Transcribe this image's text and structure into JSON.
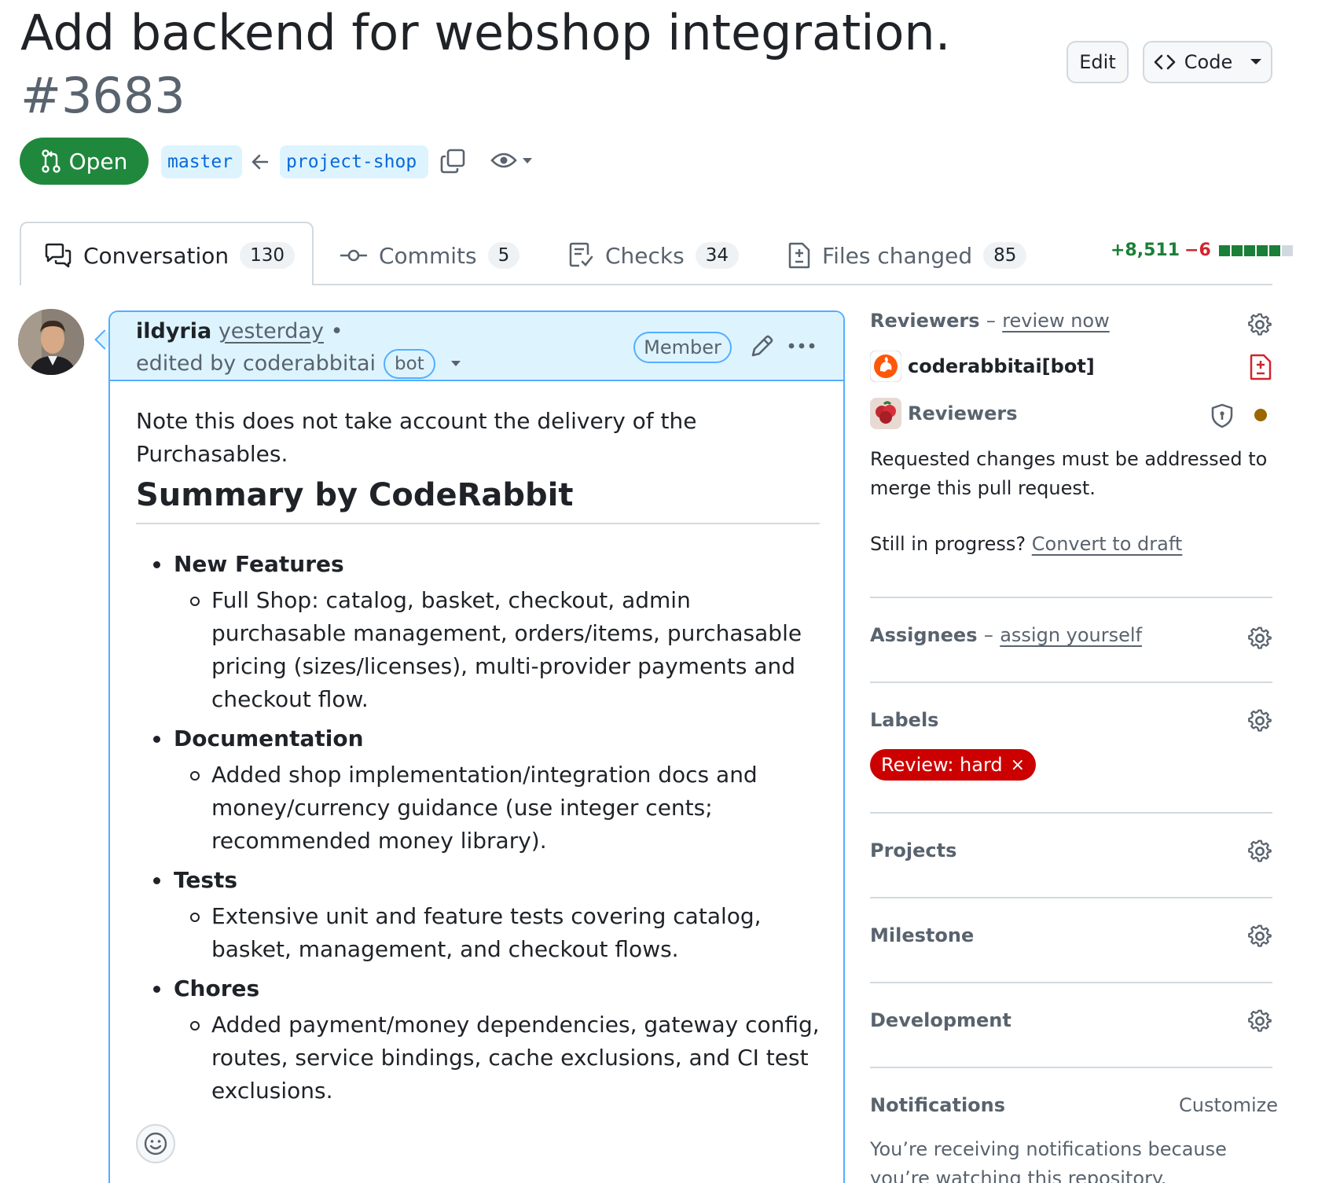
{
  "pr": {
    "title": "Add backend for webshop integration.",
    "number": "#3683",
    "state": "Open",
    "base_branch": "master",
    "head_branch": "project-shop"
  },
  "actions": {
    "edit": "Edit",
    "code": "Code"
  },
  "tabs": [
    {
      "label": "Conversation",
      "count": "130"
    },
    {
      "label": "Commits",
      "count": "5"
    },
    {
      "label": "Checks",
      "count": "34"
    },
    {
      "label": "Files changed",
      "count": "85"
    }
  ],
  "diffstat": {
    "additions": "+8,511",
    "deletions": "−6",
    "blocks": [
      "#1a7f37",
      "#1a7f37",
      "#1a7f37",
      "#1a7f37",
      "#1a7f37",
      "#d1d9e0"
    ]
  },
  "comment": {
    "author": "ildyria",
    "time": "yesterday",
    "bullet_sep": "•",
    "edited_by": "edited by coderabbitai",
    "bot_label": "bot",
    "member_label": "Member",
    "note": "Note this does not take account the delivery of the Purchasables.",
    "summary_heading": "Summary by CodeRabbit",
    "summary": [
      {
        "title": "New Features",
        "detail": "Full Shop: catalog, basket, checkout, admin purchasable management, orders/items, purchasable pricing (sizes/licenses), multi-provider payments and checkout flow."
      },
      {
        "title": "Documentation",
        "detail": "Added shop implementation/integration docs and money/currency guidance (use integer cents; recommended money library)."
      },
      {
        "title": "Tests",
        "detail": "Extensive unit and feature tests covering catalog, basket, management, and checkout flows."
      },
      {
        "title": "Chores",
        "detail": "Added payment/money dependencies, gateway config, routes, service bindings, cache exclusions, and CI test exclusions."
      }
    ]
  },
  "sidebar": {
    "reviewers": {
      "heading": "Reviewers",
      "sep": "–",
      "link": "review now",
      "items": [
        "coderabbitai[bot]",
        "Reviewers"
      ],
      "requested_text": "Requested changes must be addressed to merge this pull request.",
      "progress_text": "Still in progress?",
      "convert_link": "Convert to draft"
    },
    "assignees": {
      "heading": "Assignees",
      "sep": "–",
      "link": "assign yourself"
    },
    "labels": {
      "heading": "Labels",
      "items": [
        {
          "name": "Review: hard",
          "color": "#cc0000",
          "remove": "×"
        }
      ]
    },
    "projects": {
      "heading": "Projects"
    },
    "milestone": {
      "heading": "Milestone"
    },
    "development": {
      "heading": "Development"
    },
    "notifications": {
      "heading": "Notifications",
      "customize": "Customize",
      "text": "You’re receiving notifications because you’re watching this repository."
    }
  }
}
